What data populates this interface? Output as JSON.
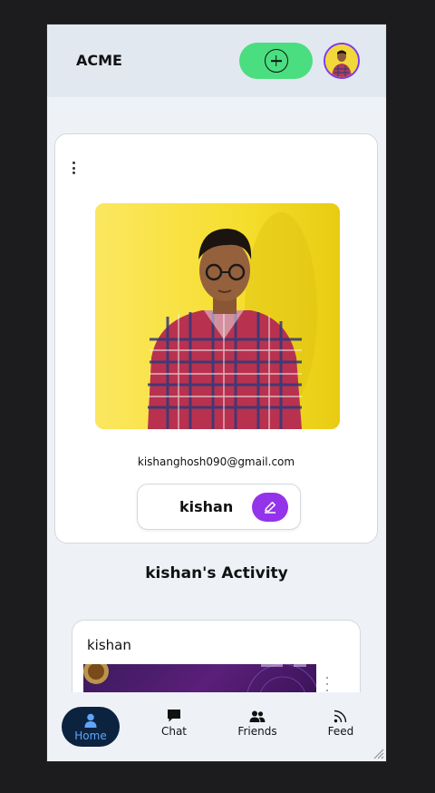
{
  "header": {
    "brand": "ACME",
    "add_icon": "plus-circle-icon",
    "avatar_icon": "user-avatar"
  },
  "profile": {
    "menu_icon": "vertical-dots-icon",
    "email": "kishanghosh090@gmail.com",
    "name": "kishan",
    "edit_icon": "pencil-icon"
  },
  "activity": {
    "title": "kishan's Activity",
    "posts": [
      {
        "author": "kishan"
      }
    ]
  },
  "bottom_nav": {
    "items": [
      {
        "label": "Home",
        "icon": "user-icon",
        "active": true
      },
      {
        "label": "Chat",
        "icon": "chat-bubble-icon",
        "active": false
      },
      {
        "label": "Friends",
        "icon": "users-icon",
        "active": false
      },
      {
        "label": "Feed",
        "icon": "rss-icon",
        "active": false
      }
    ]
  },
  "colors": {
    "accent_green": "#4ade80",
    "accent_purple": "#9333ea",
    "nav_active_bg": "#0c2340",
    "nav_active_fg": "#60a5fa"
  }
}
